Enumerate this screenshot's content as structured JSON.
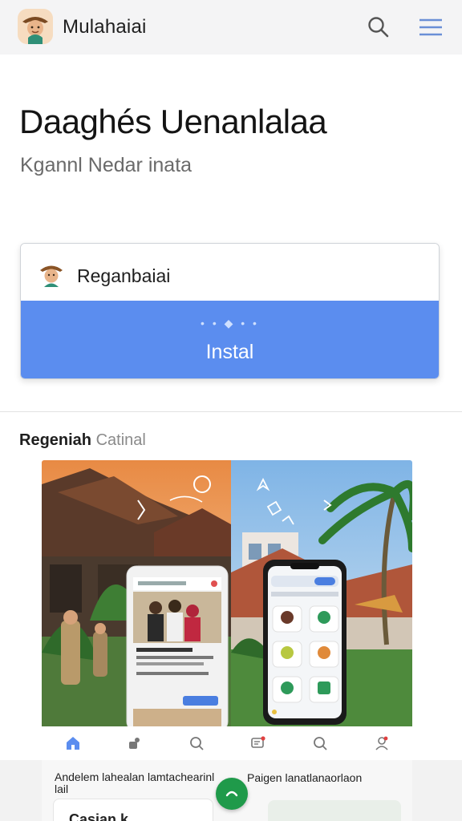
{
  "header": {
    "app_name": "Mulahaiai",
    "icons": [
      "avatar-logo-icon",
      "search-icon",
      "menu-icon"
    ]
  },
  "hero": {
    "title": "Daaghés Uenanlalaa",
    "subtitle": "Kgannl Nedar inata"
  },
  "install_card": {
    "app_name": "Reganbaiai",
    "dots": "• • ◆ • •",
    "button_label": "Instal"
  },
  "section": {
    "title_strong": "Regeniah",
    "title_light": "Catinal"
  },
  "bottom_nav": {
    "items": [
      "home-icon",
      "people-icon",
      "search-icon",
      "messages-icon",
      "search-icon",
      "profile-icon"
    ]
  },
  "bottom_panel": {
    "left_text": "Andelem lahealan lamtachearinl lail",
    "right_text": "Paigen lanatlanaorlaon",
    "left_card_label": "Casian k"
  },
  "colors": {
    "accent": "#5b8def",
    "fab": "#1f9a4a",
    "topbar_bg": "#f4f4f5"
  }
}
